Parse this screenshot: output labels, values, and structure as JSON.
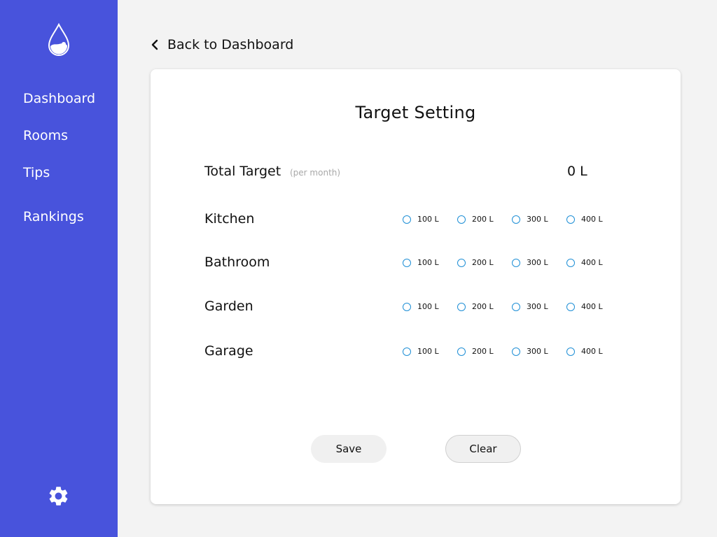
{
  "sidebar": {
    "items": [
      {
        "label": "Dashboard"
      },
      {
        "label": "Rooms"
      },
      {
        "label": "Tips"
      },
      {
        "label": "Rankings"
      }
    ],
    "logo_icon": "water-drop-icon",
    "settings_icon": "gear-icon",
    "bg_color": "#4853dc"
  },
  "header": {
    "back_label": "Back to Dashboard",
    "back_icon": "chevron-left-icon"
  },
  "card": {
    "title": "Target Setting",
    "total": {
      "label": "Total Target",
      "sublabel": "(per month)",
      "value": "0 L"
    },
    "options": [
      "100 L",
      "200 L",
      "300 L",
      "400 L"
    ],
    "rooms": [
      {
        "name": "Kitchen",
        "selected": null
      },
      {
        "name": "Bathroom",
        "selected": null
      },
      {
        "name": "Garden",
        "selected": null
      },
      {
        "name": "Garage",
        "selected": null
      }
    ],
    "buttons": {
      "save": "Save",
      "clear": "Clear"
    },
    "radio_color": "#1e8fd6"
  }
}
